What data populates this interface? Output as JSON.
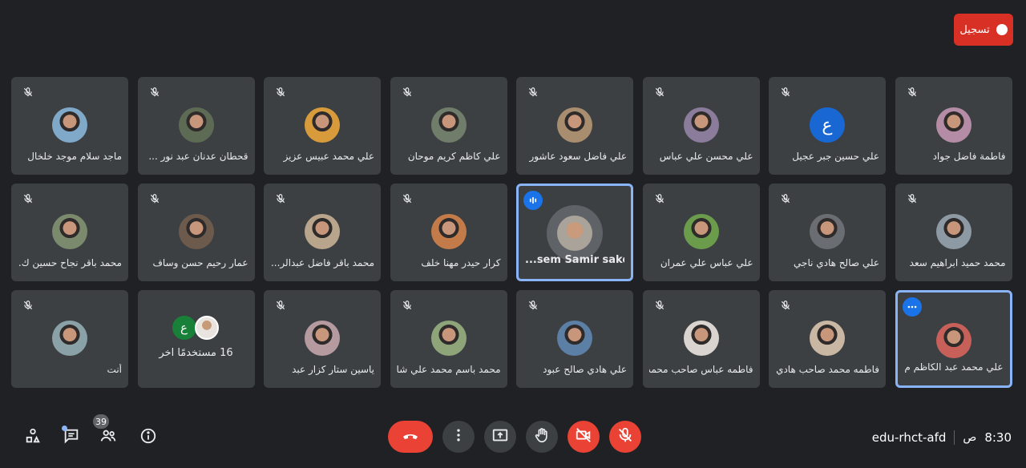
{
  "recording": {
    "label": "تسجيل"
  },
  "participants": [
    {
      "name": "فاطمة فاضل جواد",
      "avatar": "photo",
      "color": "#b48ca6",
      "muted": true
    },
    {
      "name": "علي حسين جبر عجيل",
      "avatar": "letter",
      "letter": "ع",
      "color": "#1967d2",
      "muted": true
    },
    {
      "name": "علي محسن علي عباس",
      "avatar": "photo",
      "color": "#8a7c9a",
      "muted": true
    },
    {
      "name": "علي فاضل سعود عاشور",
      "avatar": "photo",
      "color": "#a98d6f",
      "muted": true
    },
    {
      "name": "علي كاظم كريم موحان",
      "avatar": "photo",
      "color": "#6f7d6a",
      "muted": true
    },
    {
      "name": "علي محمد عبيس عزيز",
      "avatar": "photo",
      "color": "#d89b3c",
      "muted": true
    },
    {
      "name": "قحطان عدنان عبد نور ...",
      "avatar": "photo",
      "color": "#5d6b55",
      "muted": true
    },
    {
      "name": "ماجد سلام موجد خلخال",
      "avatar": "photo",
      "color": "#7fa8c9",
      "muted": true
    },
    {
      "name": "محمد حميد ابراهيم سعد",
      "avatar": "photo",
      "color": "#8d9aa4",
      "muted": true
    },
    {
      "name": "علي صالح هادي ناجي",
      "avatar": "photo",
      "color": "#6a6e72",
      "muted": true
    },
    {
      "name": "علي عباس علي عمران",
      "avatar": "photo",
      "color": "#6b9c4c",
      "muted": true
    },
    {
      "name": "...sem Samir saker",
      "avatar": "ring",
      "color": "#a9a39a",
      "speaking": true
    },
    {
      "name": "كرار حيدر مهنا خلف",
      "avatar": "photo",
      "color": "#c47b4a",
      "muted": true
    },
    {
      "name": "محمد باقر فاضل عبدالر...",
      "avatar": "photo",
      "color": "#b9a58c",
      "muted": true
    },
    {
      "name": "عمار رحيم حسن وساف",
      "avatar": "photo",
      "color": "#6c5b4c",
      "muted": true
    },
    {
      "name": "محمد باقر نجاح حسين ك...",
      "avatar": "photo",
      "color": "#7b8a6d",
      "muted": true
    },
    {
      "name": "علي محمد عبد الكاظم م...",
      "avatar": "photo",
      "color": "#c66058",
      "more": true
    },
    {
      "name": "فاطمه محمد صاحب هادي",
      "avatar": "photo",
      "color": "#c9b7a4",
      "muted": true
    },
    {
      "name": "فاطمه عباس صاحب محمد",
      "avatar": "photo",
      "color": "#d9d4cf",
      "muted": true
    },
    {
      "name": "علي هادي صالح عبود",
      "avatar": "photo",
      "color": "#5b7fa5",
      "muted": true
    },
    {
      "name": "محمد باسم محمد علي شا...",
      "avatar": "photo",
      "color": "#8ea57a",
      "muted": true
    },
    {
      "name": "ياسين ستار كزار عبد",
      "avatar": "photo",
      "color": "#b59aa0",
      "muted": true
    },
    {
      "name": "16 مستخدمًا آخر",
      "avatar": "pair",
      "letter": "ع",
      "color": "#188038",
      "muted": false
    },
    {
      "name": "أنت",
      "avatar": "photo",
      "color": "#8aa2a7",
      "muted": true
    }
  ],
  "meeting": {
    "code": "edu-rhct-afd",
    "time": "8:30",
    "ampm": "ص"
  },
  "people_count": "39",
  "icons": {
    "mic_off": "mic-off-icon",
    "hangup": "call-end-icon",
    "more": "more-vert-icon",
    "present": "present-screen-icon",
    "raise_hand": "hand-icon",
    "camera_off": "videocam-off-icon",
    "info": "info-icon",
    "people": "people-icon",
    "chat": "chat-icon",
    "activities": "activities-icon"
  },
  "colors": {
    "accent_red": "#ea4335",
    "highlight": "#8ab4f8",
    "bg": "#202124",
    "tile": "#3c4043"
  }
}
